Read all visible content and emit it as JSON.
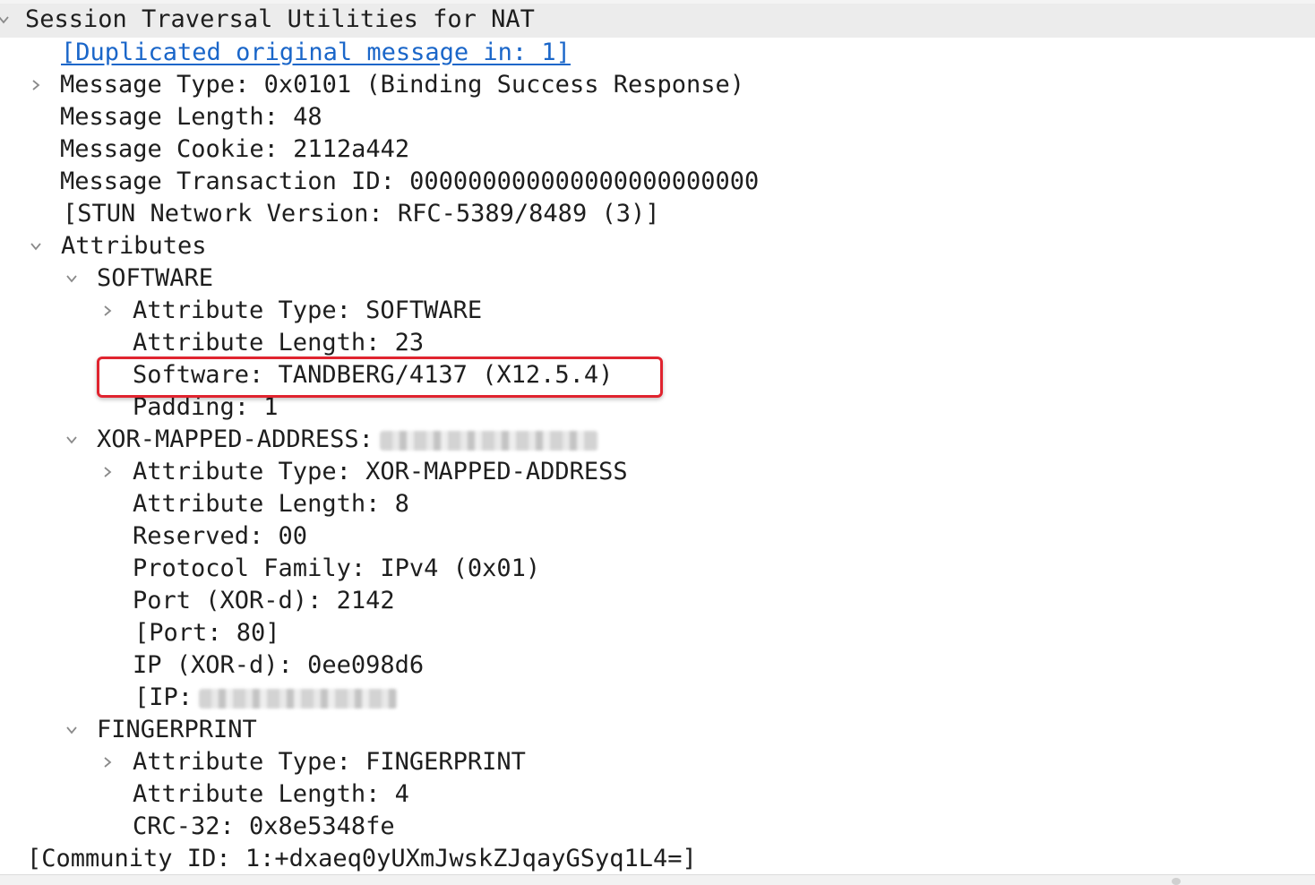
{
  "tree": {
    "header": {
      "label": "Session Traversal Utilities for NAT"
    },
    "duplicated_link": "[Duplicated original message in: 1]",
    "message_type": "Message Type: 0x0101 (Binding Success Response)",
    "message_length": "Message Length: 48",
    "message_cookie": "Message Cookie: 2112a442",
    "transaction_id": "Message Transaction ID: 000000000000000000000000",
    "stun_version": "[STUN Network Version: RFC-5389/8489 (3)]",
    "attributes": {
      "label": "Attributes",
      "software": {
        "label": "SOFTWARE",
        "attr_type": "Attribute Type: SOFTWARE",
        "attr_length": "Attribute Length: 23",
        "software": "Software: TANDBERG/4137 (X12.5.4)",
        "padding": "Padding: 1"
      },
      "xor_mapped": {
        "label": "XOR-MAPPED-ADDRESS:",
        "attr_type": "Attribute Type: XOR-MAPPED-ADDRESS",
        "attr_length": "Attribute Length: 8",
        "reserved": "Reserved: 00",
        "protocol_family": "Protocol Family: IPv4 (0x01)",
        "port_xor": "Port (XOR-d): 2142",
        "port": "[Port: 80]",
        "ip_xor": "IP (XOR-d): 0ee098d6",
        "ip": "[IP:"
      },
      "fingerprint": {
        "label": "FINGERPRINT",
        "attr_type": "Attribute Type: FINGERPRINT",
        "attr_length": "Attribute Length: 4",
        "crc": "CRC-32: 0x8e5348fe"
      }
    },
    "community_id": "[Community ID: 1:+dxaeq0yUXmJwskZJqayGSyq1L4=]"
  },
  "icons": {
    "expanded": "chevron-down-icon",
    "collapsed": "chevron-right-icon"
  },
  "colors": {
    "highlight": "#e0242f",
    "link": "#1a66c9",
    "header_bg": "#ececec"
  }
}
